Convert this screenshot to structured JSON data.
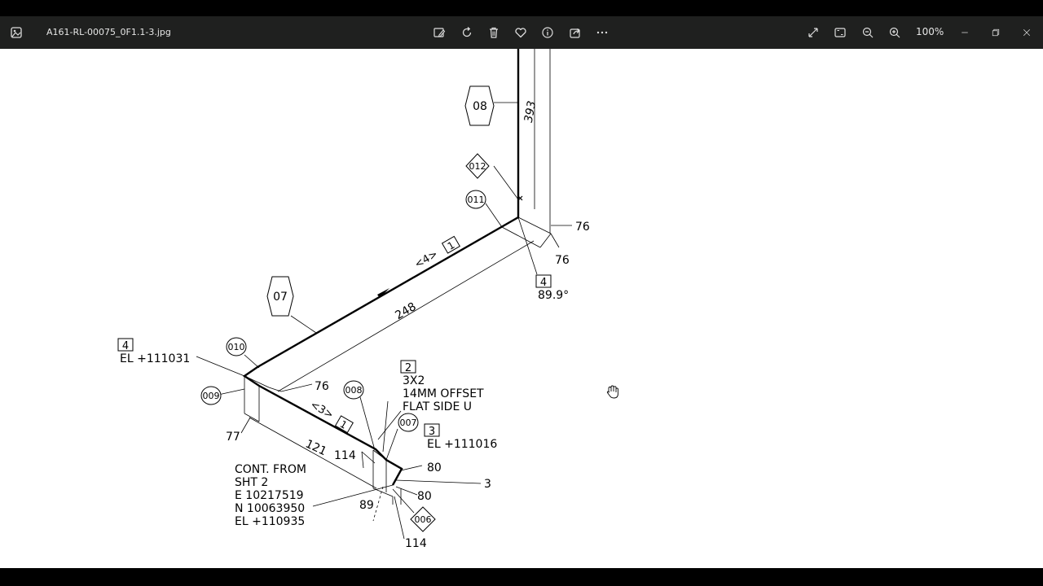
{
  "window": {
    "filename": "A161-RL-00075_0F1.1-3.jpg",
    "zoom_level": "100%"
  },
  "toolbar": {
    "icons": [
      "edit-image-icon",
      "rotate-icon",
      "delete-icon",
      "favorite-icon",
      "info-icon",
      "share-icon",
      "more-icon"
    ],
    "right_icons": [
      "fullscreen-icon",
      "fit-to-window-icon",
      "zoom-out-icon",
      "zoom-in-icon"
    ]
  },
  "drawing": {
    "components": {
      "c08": "08",
      "c07": "07",
      "c012": "012",
      "c011": "011",
      "c010": "010",
      "c009": "009",
      "c008": "008",
      "c007": "007",
      "c006": "006"
    },
    "dimensions": {
      "d393": "393",
      "d76a": "76",
      "d76b": "76",
      "d248": "248",
      "d76c": "76",
      "d77": "77",
      "d121": "121",
      "d114a": "114",
      "d89": "89",
      "d80a": "80",
      "d80b": "80",
      "d3": "3",
      "d114b": "114"
    },
    "tags": {
      "t4a": "4",
      "t4b": "4",
      "t1a": "1",
      "t1b": "1",
      "t2": "2",
      "t3": "3"
    },
    "notes": {
      "angle": "89.9°",
      "el1": "EL +111031",
      "el2": "EL +111016",
      "size": "3X2",
      "offset": "14MM OFFSET",
      "flat": "FLAT SIDE U",
      "lbl4a": "<4>",
      "lbl3": "<3>",
      "cont1": "CONT. FROM",
      "cont2": "SHT 2",
      "cont3": "E 10217519",
      "cont4": "N 10063950",
      "cont5": "EL +110935"
    }
  }
}
